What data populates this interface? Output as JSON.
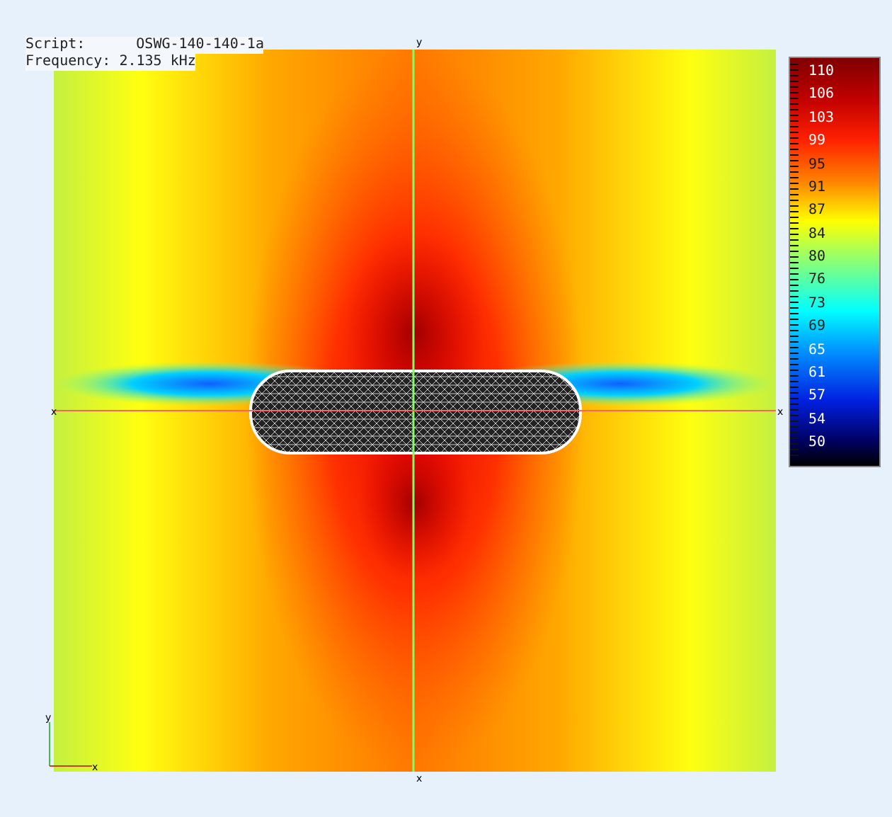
{
  "header": {
    "script_label": "Script:",
    "script_value": "OSWG-140-140-1a",
    "frequency_label": "Frequency:",
    "frequency_value": "2.135 kHz"
  },
  "plot": {
    "axis_top": "y",
    "axis_left": "x",
    "axis_right": "x",
    "axis_bottom": "x",
    "triad_y": "y",
    "triad_x": "x"
  },
  "legend": {
    "labels": [
      "110",
      "106",
      "103",
      "99",
      "95",
      "91",
      "87",
      "84",
      "80",
      "76",
      "73",
      "69",
      "65",
      "61",
      "57",
      "54",
      "50"
    ]
  }
}
